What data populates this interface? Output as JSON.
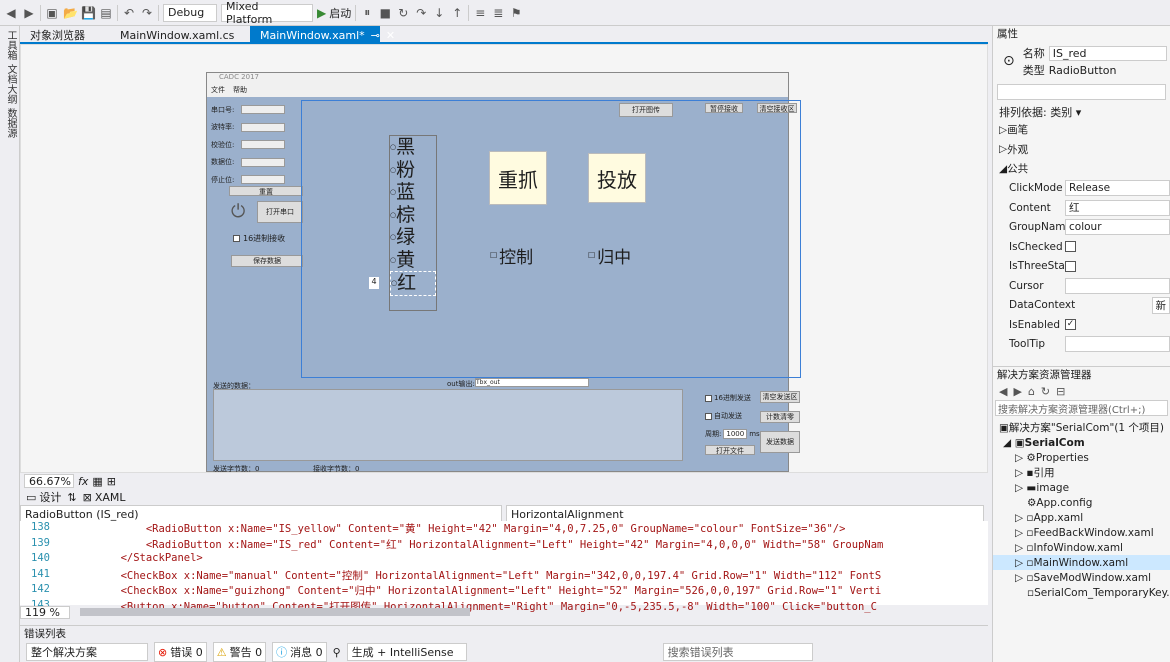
{
  "toolbar": {
    "config": "Debug",
    "platform": "Mixed Platform",
    "start": "启动"
  },
  "left_tools": [
    "工具箱",
    "文档大纲",
    "数据源"
  ],
  "tabs": [
    {
      "label": "对象浏览器"
    },
    {
      "label": "MainWindow.xaml.cs"
    },
    {
      "label": "MainWindow.xaml*",
      "active": true
    }
  ],
  "designer": {
    "win_title": "CADC 2017",
    "menu": [
      "文件",
      "帮助"
    ],
    "fields": [
      "串口号:",
      "波特率:",
      "校验位:",
      "数据位:",
      "停止位:"
    ],
    "reset": "重置",
    "open_port": "打开串口",
    "hex_recv": "16进制接收",
    "save_data": "保存数据",
    "open_img": "打开图传",
    "pause_recv": "暂停接收",
    "clear_recv": "清空接收区",
    "radios": [
      "黑",
      "粉",
      "蓝",
      "棕",
      "绿",
      "黄",
      "红"
    ],
    "grab": "重抓",
    "drop": "投放",
    "control": "控制",
    "center": "归中",
    "margin_hint": "4",
    "send_data": "发送的数据：",
    "out_label": "out输出:",
    "out_value": "Tbx_out",
    "hex_send": "16进制发送",
    "clear_send": "清空发送区",
    "auto_send": "自动发送",
    "count_clear": "计数清零",
    "period_label": "周期:",
    "period_value": "1000",
    "period_unit": "ms",
    "open_file": "打开文件",
    "send_btn": "发送数据",
    "send_bytes": "发送字节数：0",
    "recv_bytes": "接收字节数：0"
  },
  "zoom": "66.67%",
  "view": {
    "design": "设计",
    "xaml": "XAML"
  },
  "code_bar": {
    "element": "RadioButton (IS_red)",
    "property": "HorizontalAlignment"
  },
  "code_lines": [
    {
      "n": "138",
      "text": "            <RadioButton x:Name=\"IS_yellow\" Content=\"黄\" Height=\"42\" Margin=\"4,0,7.25,0\" GroupName=\"colour\" FontSize=\"36\"/>"
    },
    {
      "n": "139",
      "text": "            <RadioButton x:Name=\"IS_red\" Content=\"红\" HorizontalAlignment=\"Left\" Height=\"42\" Margin=\"4,0,0,0\" Width=\"58\" GroupNam"
    },
    {
      "n": "140",
      "text": "        </StackPanel>"
    },
    {
      "n": "141",
      "text": "        <CheckBox x:Name=\"manual\" Content=\"控制\" HorizontalAlignment=\"Left\" Margin=\"342,0,0,197.4\" Grid.Row=\"1\" Width=\"112\" FontS"
    },
    {
      "n": "142",
      "text": "        <CheckBox x:Name=\"guizhong\" Content=\"归中\" HorizontalAlignment=\"Left\" Height=\"52\" Margin=\"526,0,0,197\" Grid.Row=\"1\" Verti"
    },
    {
      "n": "143",
      "text": "        <Button x:Name=\"button\" Content=\"打开图传\" HorizontalAlignment=\"Right\" Margin=\"0,-5,235.5,-8\" Width=\"100\" Click=\"button_C"
    }
  ],
  "code_zoom": "119 %",
  "errors": {
    "title": "错误列表",
    "scope": "整个解决方案",
    "errors": "错误 0",
    "warnings": "警告 0",
    "messages": "消息 0",
    "build": "生成 + IntelliSense",
    "search": "搜索错误列表"
  },
  "properties": {
    "title": "属性",
    "name_label": "名称",
    "name_value": "IS_red",
    "type_label": "类型",
    "type_value": "RadioButton",
    "sort": "排列依据: 类别 ▾",
    "categories": [
      "画笔",
      "外观",
      "公共"
    ],
    "rows": [
      {
        "name": "ClickMode",
        "value": "Release"
      },
      {
        "name": "Content",
        "value": "红"
      },
      {
        "name": "GroupName",
        "value": "colour"
      },
      {
        "name": "IsChecked",
        "value": ""
      },
      {
        "name": "IsThreeState",
        "value": ""
      },
      {
        "name": "Cursor",
        "value": ""
      },
      {
        "name": "DataContext",
        "value": "新"
      },
      {
        "name": "IsEnabled",
        "value": "✓"
      },
      {
        "name": "ToolTip",
        "value": ""
      }
    ]
  },
  "solution": {
    "title": "解决方案资源管理器",
    "search": "搜索解决方案资源管理器(Ctrl+;)",
    "items": [
      {
        "label": "解决方案\"SerialCom\"(1 个项目)",
        "lvl": 0
      },
      {
        "label": "SerialCom",
        "lvl": 1
      },
      {
        "label": "Properties",
        "lvl": 2
      },
      {
        "label": "引用",
        "lvl": 2
      },
      {
        "label": "image",
        "lvl": 2
      },
      {
        "label": "App.config",
        "lvl": 2
      },
      {
        "label": "App.xaml",
        "lvl": 2
      },
      {
        "label": "FeedBackWindow.xaml",
        "lvl": 2
      },
      {
        "label": "InfoWindow.xaml",
        "lvl": 2
      },
      {
        "label": "MainWindow.xaml",
        "lvl": 2,
        "selected": true
      },
      {
        "label": "SaveModWindow.xaml",
        "lvl": 2
      },
      {
        "label": "SerialCom_TemporaryKey.pfx",
        "lvl": 2
      }
    ]
  }
}
